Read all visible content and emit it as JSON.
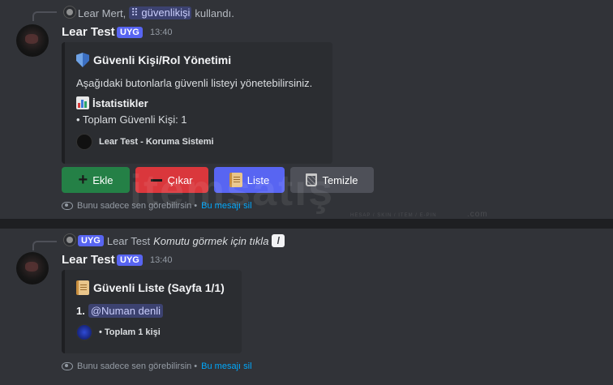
{
  "message1": {
    "reply": {
      "user": "Lear Mert,",
      "command": "güvenlikişi",
      "suffix": "kullandı."
    },
    "username": "Lear Test",
    "tag": "UYG",
    "time": "13:40",
    "embed": {
      "title": "Güvenli Kişi/Rol Yönetimi",
      "description": "Aşağıdaki butonlarla güvenli listeyi yönetebilirsiniz.",
      "field_name": "İstatistikler",
      "field_value": "• Toplam Güvenli Kişi: 1",
      "footer": "Lear Test - Koruma Sistemi"
    },
    "buttons": {
      "add": "Ekle",
      "remove": "Çıkar",
      "list": "Liste",
      "clear": "Temizle"
    },
    "ephemeral": {
      "text": "Bunu sadece sen görebilirsin •",
      "link": "Bu mesajı sil"
    }
  },
  "message2": {
    "reply": {
      "tag": "UYG",
      "user": "Lear Test",
      "text": "Komutu görmek için tıkla"
    },
    "username": "Lear Test",
    "tag": "UYG",
    "time": "13:40",
    "embed": {
      "title": "Güvenli Liste (Sayfa 1/1)",
      "item_number": "1.",
      "item_mention": "@Numan denli",
      "footer": "• Toplam 1 kişi"
    },
    "ephemeral": {
      "text": "Bunu sadece sen görebilirsin •",
      "link": "Bu mesajı sil"
    }
  },
  "watermark": {
    "brand": "itemsatış",
    "tagline": "HESAP / SKIN / ITEM / E-PIN",
    "domain": ".com"
  },
  "colors": {
    "background": "#313338",
    "embed": "#2b2d31",
    "blurple": "#5865f2",
    "green": "#248046",
    "red": "#da373c",
    "link": "#00a8fc"
  }
}
